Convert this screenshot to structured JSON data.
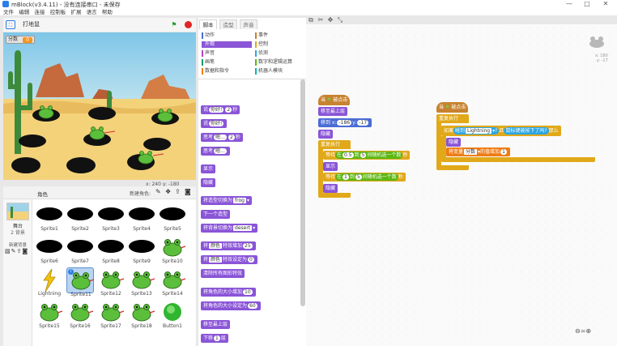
{
  "window": {
    "title": "mBlock(v3.4.11) - 没有连接串口 - 未保存",
    "minimize": "—",
    "maximize": "□",
    "close": "✕"
  },
  "menu": [
    "文件",
    "编辑",
    "连接",
    "控制板",
    "扩展",
    "语言",
    "帮助"
  ],
  "stage_bar": {
    "title": "打地鼠"
  },
  "score": {
    "label": "分数",
    "value": "0"
  },
  "coords": "x: 240  y: -180",
  "sprite_panel": {
    "header_label": "角色",
    "new_sprite_label": "新建角色:",
    "stage_label": "舞台",
    "backdrops": "2 背景",
    "new_backdrop_label": "新建背景"
  },
  "sprites": [
    {
      "name": "Sprite1",
      "kind": "hole"
    },
    {
      "name": "Sprite2",
      "kind": "hole"
    },
    {
      "name": "Sprite3",
      "kind": "hole"
    },
    {
      "name": "Sprite4",
      "kind": "hole"
    },
    {
      "name": "Sprite5",
      "kind": "hole"
    },
    {
      "name": "Sprite6",
      "kind": "hole"
    },
    {
      "name": "Sprite7",
      "kind": "hole"
    },
    {
      "name": "Sprite8",
      "kind": "hole"
    },
    {
      "name": "Sprite9",
      "kind": "hole"
    },
    {
      "name": "Sprite10",
      "kind": "frog"
    },
    {
      "name": "Lightning",
      "kind": "lightning"
    },
    {
      "name": "Sprite11",
      "kind": "frog",
      "selected": true
    },
    {
      "name": "Sprite12",
      "kind": "frog"
    },
    {
      "name": "Sprite13",
      "kind": "frog"
    },
    {
      "name": "Sprite14",
      "kind": "frog"
    },
    {
      "name": "Sprite15",
      "kind": "frog"
    },
    {
      "name": "Sprite16",
      "kind": "frog"
    },
    {
      "name": "Sprite17",
      "kind": "frog"
    },
    {
      "name": "Sprite18",
      "kind": "frog"
    },
    {
      "name": "Button1",
      "kind": "button"
    }
  ],
  "tabs": [
    "脚本",
    "造型",
    "声音"
  ],
  "categories": [
    {
      "label": "动作",
      "color": "#4a6cd4"
    },
    {
      "label": "事件",
      "color": "#c88330"
    },
    {
      "label": "外观",
      "color": "#8a55d7",
      "active": true
    },
    {
      "label": "控制",
      "color": "#e1a91a"
    },
    {
      "label": "声音",
      "color": "#bb42c3"
    },
    {
      "label": "侦测",
      "color": "#2ca5e2"
    },
    {
      "label": "画笔",
      "color": "#0e9a6c"
    },
    {
      "label": "数字和逻辑运算",
      "color": "#5cb712"
    },
    {
      "label": "数据和指令",
      "color": "#ee7d16"
    },
    {
      "label": "机器人模块",
      "color": "#0ab5b5"
    }
  ],
  "palette": {
    "say_for": {
      "pre": "说",
      "text": "你好!",
      "num": "2",
      "post": "秒"
    },
    "say": {
      "pre": "说",
      "text": "你好!"
    },
    "think_for": {
      "pre": "思考",
      "text": "嗯…",
      "num": "2",
      "post": "秒"
    },
    "think": {
      "pre": "思考",
      "text": "嗯…"
    },
    "show": "显示",
    "hide": "隐藏",
    "switch_costume": {
      "pre": "将造型切换为",
      "dd": "frog"
    },
    "next_costume": "下一个造型",
    "switch_backdrop": {
      "pre": "将背景切换为",
      "dd": "desert"
    },
    "change_effect": {
      "pre": "将",
      "dd": "颜色",
      "mid": "特效增加",
      "num": "25"
    },
    "set_effect": {
      "pre": "将",
      "dd": "颜色",
      "mid": "特效设定为",
      "num": "0"
    },
    "clear_effects": "清除所有图形特效",
    "change_size": {
      "pre": "将角色的大小增加",
      "num": "10"
    },
    "set_size": {
      "pre": "将角色的大小设定为",
      "num": "60"
    },
    "front": "移至最上层",
    "back_layers": {
      "pre": "下移",
      "num": "1",
      "post": "层"
    }
  },
  "script1": {
    "hat": {
      "pre": "当",
      "post": "被点击"
    },
    "front": "移至最上层",
    "goto": {
      "pre": "移到 x:",
      "x": "-186",
      "ymid": "y:",
      "y": "-17"
    },
    "hide": "隐藏",
    "forever": "重复执行",
    "wait1": {
      "pre": "等待",
      "dd": "在",
      "a": "0.5",
      "mid": "到",
      "b": "5",
      "post": "间随机选一个数",
      "end": "秒"
    },
    "show": "显示",
    "wait2": {
      "pre": "等待",
      "dd": "在",
      "a": "1",
      "mid": "到",
      "b": "5",
      "post": "间随机选一个数",
      "end": "秒"
    },
    "hide2": "隐藏"
  },
  "script2": {
    "hat": {
      "pre": "当",
      "post": "被点击"
    },
    "forever": "重复执行",
    "if": {
      "pre": "如果",
      "sense": "碰到",
      "dd": "Lightning",
      "q": "?",
      "and": "且",
      "mouse": "鼠标键被按下了吗?",
      "post": "那么"
    },
    "hide": "隐藏",
    "change_var": {
      "pre": "将变量",
      "dd": "分数",
      "mid": "的值增加",
      "num": "1"
    }
  },
  "sprite_thumb_coords": {
    "x": "x: 180",
    "y": "y: -17"
  }
}
